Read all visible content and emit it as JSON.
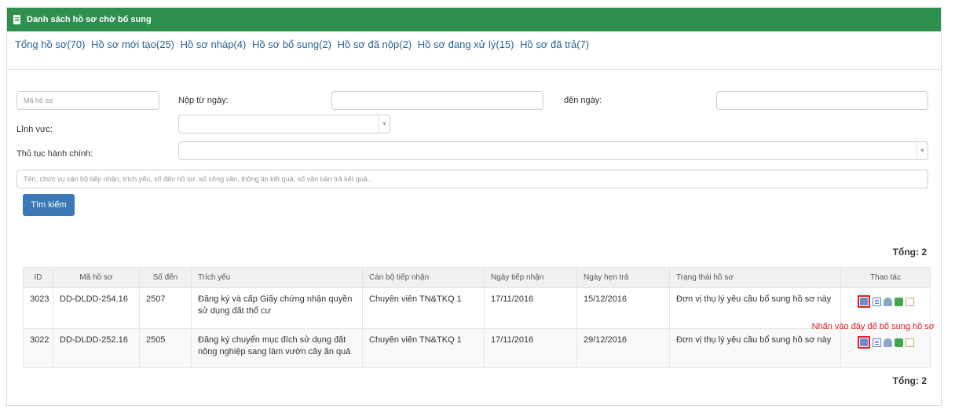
{
  "panel": {
    "title": "Danh sách hồ sơ chờ bổ sung"
  },
  "tabs": [
    "Tổng hồ sơ(70)",
    "Hồ sơ mới tạo(25)",
    "Hồ sơ nháp(4)",
    "Hồ sơ bổ sung(2)",
    "Hồ sơ đã nộp(2)",
    "Hồ sơ đang xử lý(15)",
    "Hồ sơ đã trả(7)"
  ],
  "filters": {
    "code_placeholder": "Mã hồ sơ",
    "from_label": "Nộp từ ngày:",
    "to_label": "đến ngày:",
    "field_label": "Lĩnh vực:",
    "procedure_label": "Thủ tục hành chính:",
    "keyword_placeholder": "Tên, chức vụ cán bộ tiếp nhận, trích yếu, số đến hồ sơ, số công văn, thông tin kết quả, số văn bản trả kết quả...",
    "search_button": "Tìm kiếm"
  },
  "total_label": "Tổng: 2",
  "table": {
    "headers": [
      "ID",
      "Mã hồ sơ",
      "Số đến",
      "Trích yếu",
      "Cán bộ tiếp nhận",
      "Ngày tiếp nhận",
      "Ngày hẹn trả",
      "Trạng thái hồ sơ",
      "Thao tác"
    ],
    "rows": [
      [
        "3023",
        "DD-DLDD-254.16",
        "2507",
        "Đăng ký và cấp Giấy chứng nhận quyền sử dụng đất thổ cư",
        "Chuyên viên TN&TKQ 1",
        "17/11/2016",
        "15/12/2016",
        "Đơn vị thụ lý yêu cầu bổ sung hồ sơ này"
      ],
      [
        "3022",
        "DD-DLDD-252.16",
        "2505",
        "Đăng ký chuyển mục đích sử dụng đất nông nghiệp sang làm vườn cây ăn quả",
        "Chuyên viên TN&TKQ 1",
        "17/11/2016",
        "29/12/2016",
        "Đơn vị thụ lý yêu cầu bổ sung hồ sơ này"
      ]
    ]
  },
  "annotation": "Nhấn vào đây để bổ sung hồ sơ",
  "icons": [
    "supplement-icon",
    "list-icon",
    "print-icon",
    "word-doc-icon",
    "file-icon"
  ]
}
